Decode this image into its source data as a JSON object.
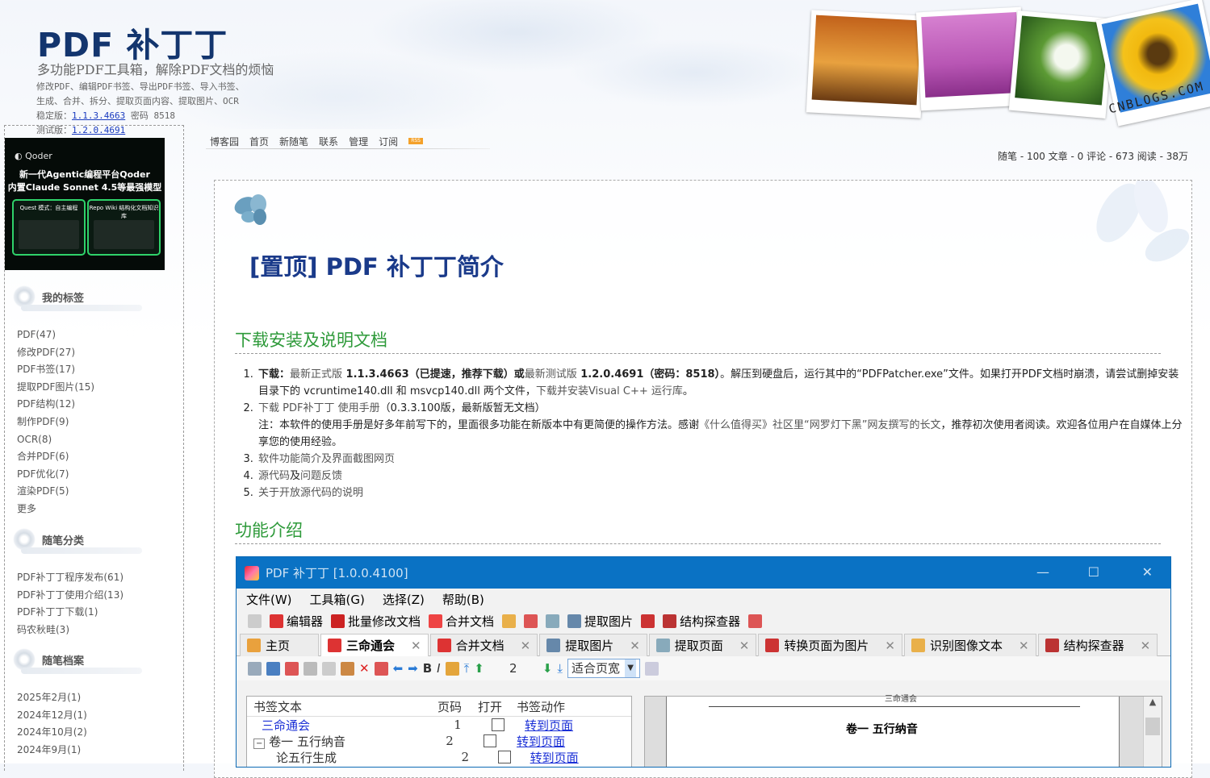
{
  "header": {
    "title": "PDF 补丁丁",
    "subtitle": "多功能PDF工具箱，解除PDF文档的烦恼",
    "desc1": "修改PDF、编辑PDF书签、导出PDF书签、导入书签、",
    "desc2": "生成、合并、拆分、提取页面内容、提取图片、OCR",
    "stable_label": "稳定版：",
    "stable_version": "1.1.3.4663",
    "stable_pwd": " 密码 8518",
    "test_label": "测试版：",
    "test_version": "1.2.0.4691",
    "photo_caption": "CNBLOGS.COM"
  },
  "ad": {
    "brand": "Qoder",
    "line1": "新一代Agentic编程平台Qoder",
    "line2": "内置Claude Sonnet 4.5等最强模型",
    "card1": "Quest 模式：自主编程",
    "card2": "Repo Wiki 结构化文档知识库"
  },
  "sidebar": {
    "tags_title": "我的标签",
    "tags": [
      "PDF(47)",
      "修改PDF(27)",
      "PDF书签(17)",
      "提取PDF图片(15)",
      "PDF结构(12)",
      "制作PDF(9)",
      "OCR(8)",
      "合并PDF(6)",
      "PDF优化(7)",
      "渲染PDF(5)",
      "更多"
    ],
    "cats_title": "随笔分类",
    "cats": [
      "PDF补丁丁程序发布(61)",
      "PDF补丁丁使用介绍(13)",
      "PDF补丁丁下载(1)",
      "码农秋畦(3)"
    ],
    "archive_title": "随笔档案",
    "archive": [
      "2025年2月(1)",
      "2024年12月(1)",
      "2024年10月(2)",
      "2024年9月(1)"
    ]
  },
  "nav": {
    "items": [
      "博客园",
      "首页",
      "新随笔",
      "联系",
      "管理",
      "订阅"
    ],
    "rss": "RSS",
    "stats": "随笔 - 100  文章 - 0  评论 - 673  阅读 - 38万"
  },
  "post": {
    "title": "[置顶] PDF 补丁丁简介",
    "section1": "下载安装及说明文档",
    "item1_label": "下载：",
    "item1_stable": "最新正式版",
    "item1_stable_ver": " 1.1.3.4663（已提速，推荐下载）或",
    "item1_test": "最新测试版",
    "item1_test_ver": " 1.2.0.4691（密码：8518）",
    "item1_rest": "。解压到硬盘后，运行其中的“PDFPatcher.exe”文件。如果打开PDF文档时崩溃，请尝试删掉安装目录下的 vcruntime140.dll 和 msvcp140.dll 两个文件，",
    "item1_vc": "下载并安装Visual C++ 运行库",
    "item1_end": "。",
    "item2_link": "下载 PDF补丁丁 使用手册",
    "item2_rest": "（0.3.3.100版，最新版暂无文档）",
    "item2_note1": "注：本软件的使用手册是好多年前写下的，里面很多功能在新版本中有更简便的操作方法。感谢",
    "item2_note_link": "《什么值得买》社区里“网罗灯下黑”网友撰写的长文",
    "item2_note2": "，推荐初次使用者阅读。欢迎各位用户在自媒体上分享您的使用经验。",
    "item3": "软件功能简介及界面截图网页",
    "item4_a": "源代码",
    "item4_b": "及",
    "item4_c": "问题反馈",
    "item5": "关于开放源代码的说明",
    "section2": "功能介绍"
  },
  "app": {
    "title": "PDF 补丁丁 [1.0.0.4100]",
    "menus": [
      "文件(W)",
      "工具箱(G)",
      "选择(Z)",
      "帮助(B)"
    ],
    "toolbar": [
      "编辑器",
      "批量修改文档",
      "合并文档",
      "提取图片",
      "结构探查器"
    ],
    "tabs": [
      "主页",
      "三命通会",
      "合并文档",
      "提取图片",
      "提取页面",
      "转换页面为图片",
      "识别图像文本",
      "结构探查器"
    ],
    "page_number": "2",
    "fit": "适合页宽",
    "table_headers": [
      "书签文本",
      "页码",
      "打开",
      "书签动作"
    ],
    "rows": [
      {
        "text": "三命通会",
        "page": "1",
        "action": "转到页面"
      },
      {
        "text": "卷一  五行纳音",
        "page": "2",
        "action": "转到页面"
      },
      {
        "text": "论五行生成",
        "page": "2",
        "action": "转到页面"
      }
    ],
    "page_header": "三命通会",
    "page_heading": "卷一   五行纳音"
  }
}
